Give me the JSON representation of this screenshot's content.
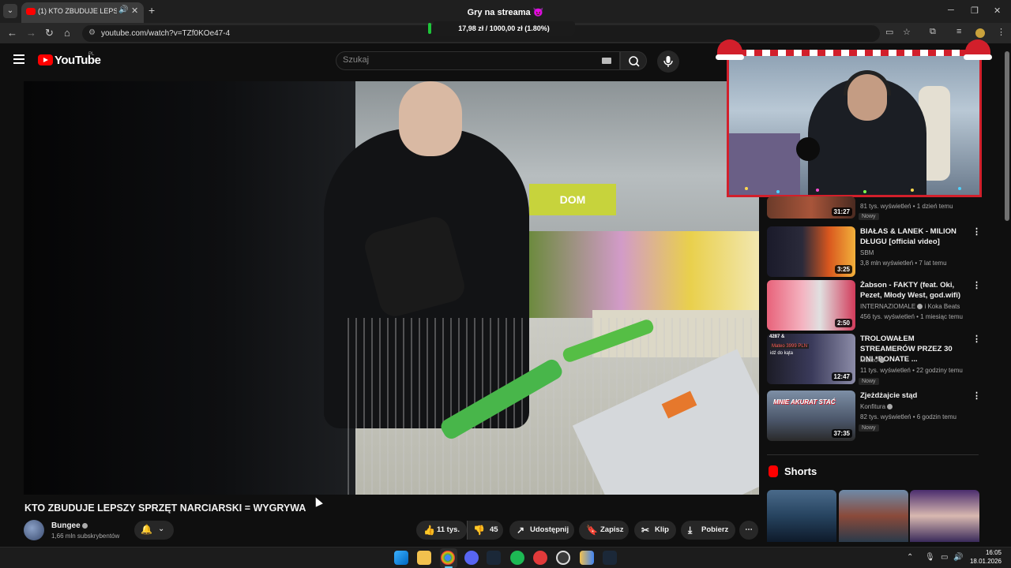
{
  "browser": {
    "tab_title": "(1) KTO ZBUDUJE LEPSZY SPRZĘT",
    "stream_title": "Gry na streama 😈",
    "donation_goal": "17,98 zł / 1000,00 zł (1.80%)",
    "donation_progress": 0.018,
    "url": "youtube.com/watch?v=TZf0KOe47-4"
  },
  "youtube": {
    "logo_text": "YouTube",
    "region": "PL",
    "search_placeholder": "Szukaj"
  },
  "video": {
    "title": "KTO ZBUDUJE LEPSZY SPRZĘT NARCIARSKI = WYGRYWA",
    "sign_text": "DOM",
    "channel": {
      "name": "Bungee",
      "subscribers": "1,66 mln subskrybentów"
    },
    "actions": {
      "likes": "11 tys.",
      "dislikes": "45",
      "share": "Udostępnij",
      "save": "Zapisz",
      "clip": "Klip",
      "download": "Pobierz"
    }
  },
  "suggestions": [
    {
      "title": "",
      "channel": "",
      "meta": "81 tys. wyświetleń • 1 dzień temu",
      "badge": "Nowy",
      "duration": "31:27"
    },
    {
      "title": "BIAŁAS & LANEK - MILION DŁUGU [official video]",
      "channel": "SBM",
      "meta": "3,8 mln wyświetleń • 7 lat temu",
      "badge": "",
      "duration": "3:25"
    },
    {
      "title": "Żabson - FAKTY (feat. Oki, Pezet, Młody West, god.wifi)",
      "channel": "INTERNAZIOMALE",
      "channel_suffix": "i Koka Beats",
      "meta": "456 tys. wyświetleń • 1 miesiąc temu",
      "badge": "",
      "duration": "2:50"
    },
    {
      "title": "TROLOWAŁEM STREAMERÓW PRZEZ 30 DNI *DONATE ...",
      "channel": "Mateo",
      "meta": "11 tys. wyświetleń • 22 godziny temu",
      "badge": "Nowy",
      "duration": "12:47",
      "thumb_text_1": "Mateo 3999 PLN",
      "thumb_text_2": "idź do kąta",
      "thumb_text_3": "4287 &"
    },
    {
      "title": "Zjeżdżajcie stąd",
      "channel": "Konfitura",
      "meta": "82 tys. wyświetleń • 6 godzin temu",
      "badge": "Nowy",
      "duration": "37:35",
      "thumb_text_1": "MNIE AKURAT STAĆ"
    }
  ],
  "shorts": {
    "label": "Shorts"
  },
  "taskbar": {
    "time": "16:05",
    "date": "18.01.2026"
  },
  "colors": {
    "background": "#0f0f0f",
    "youtube_red": "#ff0000",
    "progress_green": "#1ec53a"
  }
}
